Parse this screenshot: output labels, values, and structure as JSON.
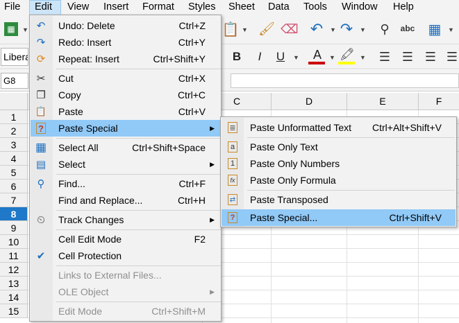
{
  "menubar": {
    "items": [
      "File",
      "Edit",
      "View",
      "Insert",
      "Format",
      "Styles",
      "Sheet",
      "Data",
      "Tools",
      "Window",
      "Help"
    ],
    "active": "Edit"
  },
  "toolbar": {
    "font_name": "Libera",
    "bold_label": "B",
    "italic_label": "I",
    "underline_label": "U",
    "font_color_label": "A",
    "font_color": "#cc0000",
    "highlight_color": "#ffff00",
    "spelling_label": "abc"
  },
  "name_box": {
    "value": "G8"
  },
  "grid": {
    "columns": [
      "C",
      "D",
      "E",
      "F"
    ],
    "rows": [
      "1",
      "2",
      "3",
      "4",
      "5",
      "6",
      "7",
      "8",
      "9",
      "10",
      "11",
      "12",
      "13",
      "14",
      "15"
    ],
    "selected_row": "8",
    "selected_color": "#1f78c8"
  },
  "edit_menu": {
    "items": [
      {
        "label": "Undo: Delete",
        "shortcut": "Ctrl+Z",
        "icon": "undo-icon",
        "glyph": "↶"
      },
      {
        "label": "Redo: Insert",
        "shortcut": "Ctrl+Y",
        "icon": "redo-icon",
        "glyph": "↷"
      },
      {
        "label": "Repeat: Insert",
        "shortcut": "Ctrl+Shift+Y",
        "icon": "repeat-icon",
        "glyph": "⟳"
      },
      {
        "label": "Cut",
        "shortcut": "Ctrl+X",
        "icon": "scissors-icon",
        "glyph": "✂"
      },
      {
        "label": "Copy",
        "shortcut": "Ctrl+C",
        "icon": "copy-icon",
        "glyph": "❐"
      },
      {
        "label": "Paste",
        "shortcut": "Ctrl+V",
        "icon": "paste-icon",
        "glyph": "📋"
      },
      {
        "label": "Paste Special",
        "shortcut": "",
        "icon": "paste-special-icon",
        "glyph": "?",
        "submenu": true,
        "highlighted": true
      },
      {
        "label": "Select All",
        "shortcut": "Ctrl+Shift+Space",
        "icon": "select-all-icon",
        "glyph": "▦"
      },
      {
        "label": "Select",
        "shortcut": "",
        "icon": "select-icon",
        "glyph": "▤",
        "submenu": true
      },
      {
        "label": "Find...",
        "shortcut": "Ctrl+F",
        "icon": "find-icon",
        "glyph": "⚲"
      },
      {
        "label": "Find and Replace...",
        "shortcut": "Ctrl+H",
        "icon": "",
        "glyph": ""
      },
      {
        "label": "Track Changes",
        "shortcut": "",
        "icon": "track-changes-icon",
        "glyph": "⏲",
        "submenu": true
      },
      {
        "label": "Cell Edit Mode",
        "shortcut": "F2",
        "icon": "",
        "glyph": ""
      },
      {
        "label": "Cell Protection",
        "shortcut": "",
        "icon": "checkmark-icon",
        "glyph": "✔"
      },
      {
        "label": "Links to External Files...",
        "shortcut": "",
        "icon": "",
        "glyph": "",
        "disabled": true
      },
      {
        "label": "OLE Object",
        "shortcut": "",
        "icon": "",
        "glyph": "",
        "submenu": true,
        "disabled": true
      },
      {
        "label": "Edit Mode",
        "shortcut": "Ctrl+Shift+M",
        "icon": "",
        "glyph": "",
        "disabled": true
      }
    ]
  },
  "paste_special_menu": {
    "items": [
      {
        "label": "Paste Unformatted Text",
        "shortcut": "Ctrl+Alt+Shift+V",
        "icon": "paste-unformatted-icon",
        "glyph": "≣"
      },
      {
        "label": "Paste Only Text",
        "shortcut": "",
        "icon": "paste-text-icon",
        "glyph": "a"
      },
      {
        "label": "Paste Only Numbers",
        "shortcut": "",
        "icon": "paste-numbers-icon",
        "glyph": "1"
      },
      {
        "label": "Paste Only Formula",
        "shortcut": "",
        "icon": "paste-formula-icon",
        "glyph": "fx"
      },
      {
        "label": "Paste Transposed",
        "shortcut": "",
        "icon": "paste-transposed-icon",
        "glyph": "⇄"
      },
      {
        "label": "Paste Special...",
        "shortcut": "Ctrl+Shift+V",
        "icon": "paste-special-dialog-icon",
        "glyph": "?",
        "highlighted": true
      }
    ]
  }
}
